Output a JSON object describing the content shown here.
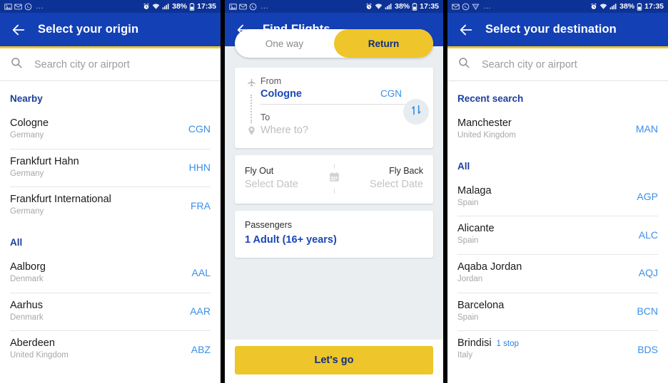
{
  "colors": {
    "header_blue": "#1340b5",
    "statusbar_blue": "#0d3296",
    "accent_yellow": "#eec52a",
    "link_blue": "#3b8fe8",
    "section_blue": "#1c3f9e",
    "card_bg_gray": "#eaeef0"
  },
  "statusbar": {
    "battery_percent": "38%",
    "time": "17:35",
    "overflow": "…",
    "icons_left_a": [
      "image-icon",
      "mail-icon",
      "whatsapp-icon"
    ],
    "icons_left_c": [
      "mail-icon",
      "whatsapp-icon",
      "notification-icon"
    ],
    "icons_right": [
      "alarm-icon",
      "wifi-icon",
      "signal-icon",
      "battery-icon"
    ]
  },
  "screen_origin": {
    "title": "Select your origin",
    "search": {
      "placeholder": "Search city or airport",
      "value": ""
    },
    "sections": [
      {
        "heading": "Nearby",
        "items": [
          {
            "city": "Cologne",
            "country": "Germany",
            "code": "CGN",
            "stop": ""
          },
          {
            "city": "Frankfurt Hahn",
            "country": "Germany",
            "code": "HHN",
            "stop": ""
          },
          {
            "city": "Frankfurt International",
            "country": "Germany",
            "code": "FRA",
            "stop": ""
          }
        ]
      },
      {
        "heading": "All",
        "items": [
          {
            "city": "Aalborg",
            "country": "Denmark",
            "code": "AAL",
            "stop": ""
          },
          {
            "city": "Aarhus",
            "country": "Denmark",
            "code": "AAR",
            "stop": ""
          },
          {
            "city": "Aberdeen",
            "country": "United Kingdom",
            "code": "ABZ",
            "stop": ""
          }
        ]
      }
    ]
  },
  "screen_search": {
    "title": "Find Flights",
    "tabs": [
      {
        "label": "One way",
        "active": false
      },
      {
        "label": "Return",
        "active": true
      }
    ],
    "route": {
      "from_label": "From",
      "from_value": "Cologne",
      "from_code": "CGN",
      "to_label": "To",
      "to_placeholder": "Where to?",
      "swap_icon": "swap-vertical-icon",
      "origin_icon": "plane-icon",
      "destination_icon": "location-pin-icon"
    },
    "dates": {
      "out_label": "Fly Out",
      "out_value": "Select Date",
      "back_label": "Fly Back",
      "back_value": "Select Date",
      "calendar_icon": "calendar-icon"
    },
    "passengers": {
      "label": "Passengers",
      "value": "1 Adult (16+ years)"
    },
    "cta": "Let's go"
  },
  "screen_destination": {
    "title": "Select your destination",
    "search": {
      "placeholder": "Search city or airport",
      "value": ""
    },
    "sections": [
      {
        "heading": "Recent search",
        "items": [
          {
            "city": "Manchester",
            "country": "United Kingdom",
            "code": "MAN",
            "stop": ""
          }
        ]
      },
      {
        "heading": "All",
        "items": [
          {
            "city": "Malaga",
            "country": "Spain",
            "code": "AGP",
            "stop": ""
          },
          {
            "city": "Alicante",
            "country": "Spain",
            "code": "ALC",
            "stop": ""
          },
          {
            "city": "Aqaba Jordan",
            "country": "Jordan",
            "code": "AQJ",
            "stop": ""
          },
          {
            "city": "Barcelona",
            "country": "Spain",
            "code": "BCN",
            "stop": ""
          },
          {
            "city": "Brindisi",
            "country": "Italy",
            "code": "BDS",
            "stop": "1 stop"
          }
        ]
      }
    ]
  }
}
